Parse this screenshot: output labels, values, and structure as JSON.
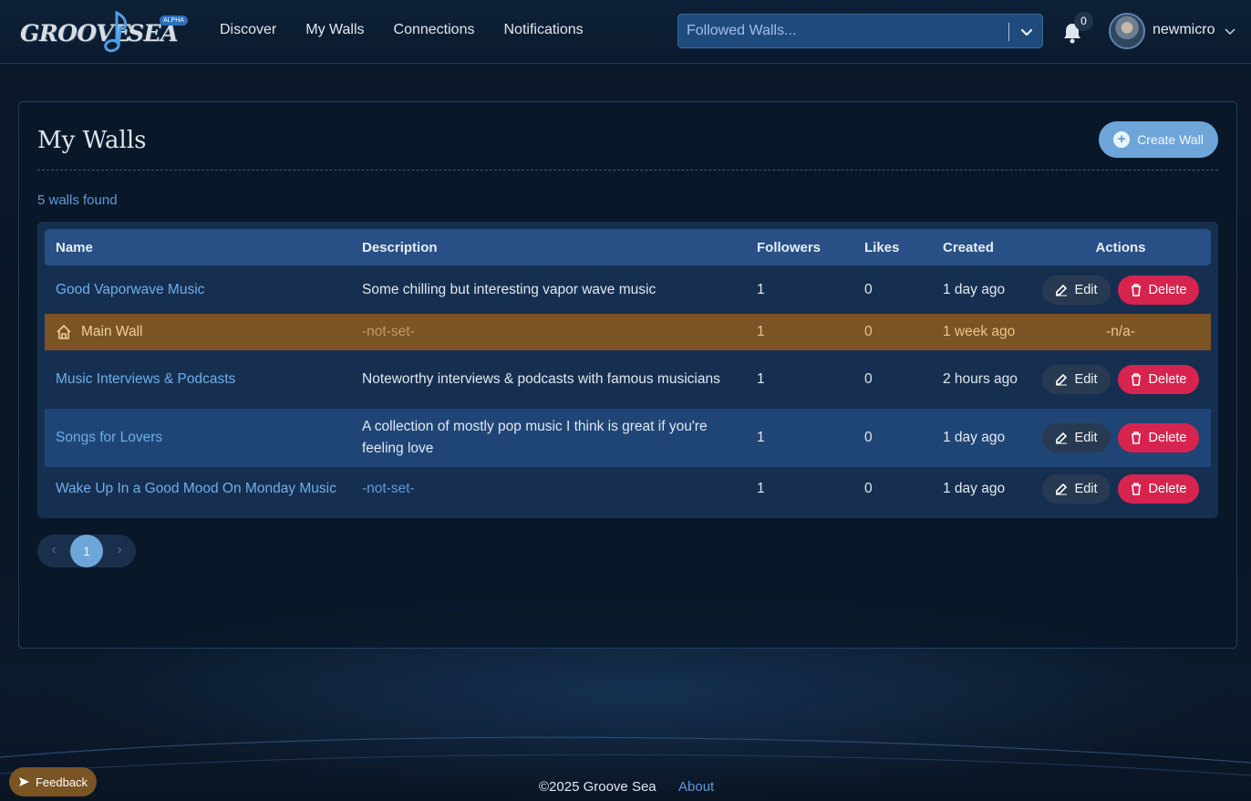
{
  "app": {
    "logo_text_left": "GROOVE",
    "logo_text_right": "SEA",
    "logo_badge": "ALPHA"
  },
  "nav": {
    "items": [
      "Discover",
      "My Walls",
      "Connections",
      "Notifications"
    ]
  },
  "search": {
    "placeholder": "Followed Walls..."
  },
  "notifications": {
    "count": "0"
  },
  "user": {
    "name": "newmicro"
  },
  "page": {
    "title": "My Walls",
    "create_label": "Create Wall",
    "count_text": "5 walls found"
  },
  "table": {
    "headers": [
      "Name",
      "Description",
      "Followers",
      "Likes",
      "Created",
      "Actions"
    ],
    "edit_label": "Edit",
    "delete_label": "Delete",
    "rows": [
      {
        "name": "Good Vaporwave Music",
        "description": "Some chilling but interesting vapor wave music",
        "followers": "1",
        "likes": "0",
        "created": "1 day ago"
      },
      {
        "name": "Main Wall",
        "description": "-not-set-",
        "followers": "1",
        "likes": "0",
        "created": "1 week ago",
        "actions": "-n/a-"
      },
      {
        "name": "Music Interviews & Podcasts",
        "description": "Noteworthy interviews & podcasts with famous musicians",
        "followers": "1",
        "likes": "0",
        "created": "2 hours ago"
      },
      {
        "name": "Songs for Lovers",
        "description": "A collection of mostly pop music I think is great if you're feeling love",
        "followers": "1",
        "likes": "0",
        "created": "1 day ago"
      },
      {
        "name": "Wake Up In a Good Mood On Monday Music",
        "description": "-not-set-",
        "followers": "1",
        "likes": "0",
        "created": "1 day ago"
      }
    ]
  },
  "pagination": {
    "current": "1",
    "prev": "‹",
    "next": "›"
  },
  "footer": {
    "copyright": "©2025 Groove Sea",
    "about": "About",
    "feedback": "Feedback"
  },
  "colors": {
    "accent": "#6ea6da",
    "delete": "#d7244f",
    "main_wall_row": "#7a5425",
    "header_row": "#285086"
  },
  "icons": [
    "music-note-icon",
    "chevron-down-icon",
    "bell-icon",
    "plus-circle-icon",
    "house-icon",
    "edit-icon",
    "trash-icon",
    "send-icon"
  ]
}
